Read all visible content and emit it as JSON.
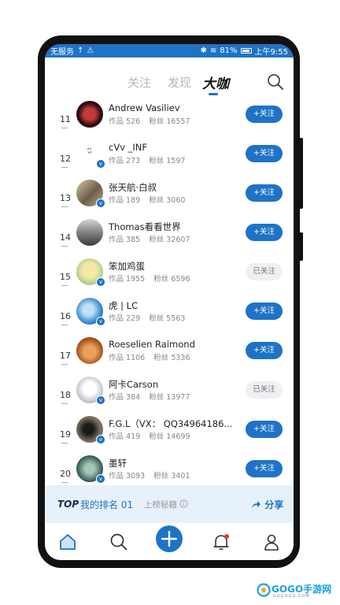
{
  "status_bar": {
    "left_text": "无服务",
    "battery": "81%",
    "time": "上午9:55"
  },
  "tabs": [
    {
      "label": "关注",
      "active": false
    },
    {
      "label": "发现",
      "active": false
    },
    {
      "label": "大咖",
      "active": true
    }
  ],
  "list": [
    {
      "rank": "11",
      "name": "Andrew Vasiliev",
      "works_label": "作品",
      "works": "526",
      "fans_label": "粉丝",
      "fans": "16557",
      "follow": "+关注",
      "followed": false,
      "verified": false,
      "avatar_color": "#3a1418"
    },
    {
      "rank": "12",
      "name": "cVv _INF",
      "works_label": "作品",
      "works": "273",
      "fans_label": "粉丝",
      "fans": "1597",
      "follow": "+关注",
      "followed": false,
      "verified": true,
      "avatar_color": "#ffffff"
    },
    {
      "rank": "13",
      "name": "张天航·白叔",
      "works_label": "作品",
      "works": "189",
      "fans_label": "粉丝",
      "fans": "3060",
      "follow": "+关注",
      "followed": false,
      "verified": true,
      "avatar_color": "#8a7a66"
    },
    {
      "rank": "14",
      "name": "Thomas看看世界",
      "works_label": "作品",
      "works": "385",
      "fans_label": "粉丝",
      "fans": "32607",
      "follow": "+关注",
      "followed": false,
      "verified": false,
      "avatar_color": "#8b8b8b"
    },
    {
      "rank": "15",
      "name": "笨加鸡蛋",
      "works_label": "作品",
      "works": "1955",
      "fans_label": "粉丝",
      "fans": "6596",
      "follow": "已关注",
      "followed": true,
      "verified": true,
      "avatar_color": "#cfe0a8"
    },
    {
      "rank": "16",
      "name": "虎 | LC",
      "works_label": "作品",
      "works": "229",
      "fans_label": "粉丝",
      "fans": "5563",
      "follow": "+关注",
      "followed": false,
      "verified": true,
      "avatar_color": "#3b8fd0"
    },
    {
      "rank": "17",
      "name": "Roeselien Raimond",
      "works_label": "作品",
      "works": "1106",
      "fans_label": "粉丝",
      "fans": "5336",
      "follow": "+关注",
      "followed": false,
      "verified": false,
      "avatar_color": "#c56a2a"
    },
    {
      "rank": "18",
      "name": "阿卡Carson",
      "works_label": "作品",
      "works": "384",
      "fans_label": "粉丝",
      "fans": "13977",
      "follow": "已关注",
      "followed": true,
      "verified": true,
      "avatar_color": "#dfe3e8"
    },
    {
      "rank": "19",
      "name": "F.G.L（VX： QQ34964186...",
      "works_label": "作品",
      "works": "419",
      "fans_label": "粉丝",
      "fans": "14699",
      "follow": "+关注",
      "followed": false,
      "verified": true,
      "avatar_color": "#4e4a44"
    },
    {
      "rank": "20",
      "name": "墨轩",
      "works_label": "作品",
      "works": "3093",
      "fans_label": "粉丝",
      "fans": "3401",
      "follow": "+关注",
      "followed": false,
      "verified": true,
      "avatar_color": "#3f6a66"
    }
  ],
  "rank_bar": {
    "top_label": "TOP",
    "my_rank": "我的排名 01",
    "secret": "上榜秘籍",
    "share": "分享"
  },
  "bottom_nav": [
    {
      "icon": "home-icon",
      "active": true
    },
    {
      "icon": "search-icon",
      "active": false
    },
    {
      "icon": "add-icon",
      "active": false
    },
    {
      "icon": "bell-icon",
      "active": false
    },
    {
      "icon": "person-icon",
      "active": false
    }
  ],
  "watermark": {
    "text": "GOGO手游网",
    "sub": "GOGOGO.COM"
  },
  "colors": {
    "accent": "#1e73c6",
    "followed_bg": "#eef0f3",
    "rank_bar_bg": "#e6f1fb"
  }
}
